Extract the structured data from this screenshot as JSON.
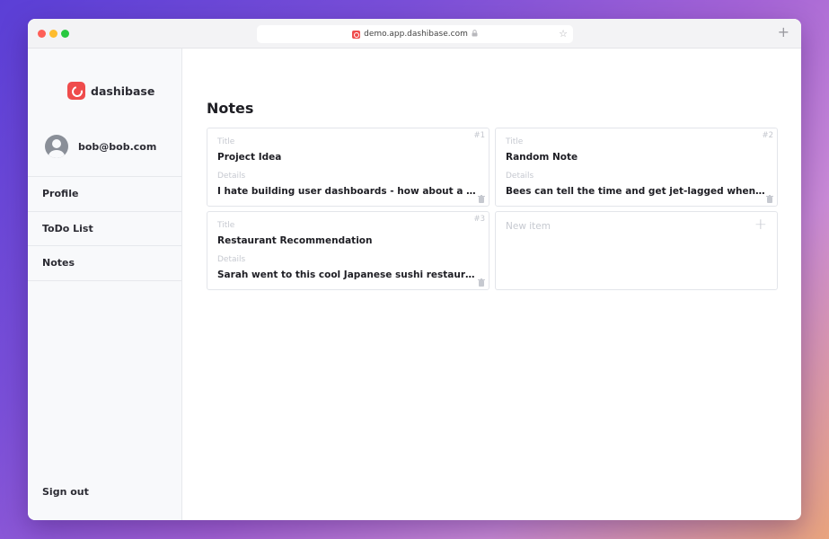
{
  "browser": {
    "url": "demo.app.dashibase.com"
  },
  "sidebar": {
    "brand": "dashibase",
    "user_email": "bob@bob.com",
    "items": [
      {
        "label": "Profile"
      },
      {
        "label": "ToDo List"
      },
      {
        "label": "Notes"
      }
    ],
    "sign_out": "Sign out"
  },
  "main": {
    "title": "Notes",
    "field_labels": {
      "title": "Title",
      "details": "Details"
    },
    "notes": [
      {
        "number": "#1",
        "title": "Project Idea",
        "details": "I hate building user dashboards - how about a no-code tool for it"
      },
      {
        "number": "#2",
        "title": "Random Note",
        "details": "Bees can tell the time and get jet-lagged when they travel far"
      },
      {
        "number": "#3",
        "title": "Restaurant Recommendation",
        "details": "Sarah went to this cool Japanese sushi restaurant downtown last week"
      }
    ],
    "new_item_label": "New item"
  },
  "colors": {
    "brand": "#ef4c4c",
    "sidebar_bg": "#f8f9fb"
  },
  "icons": {
    "url_bar": [
      "dashibase-favicon-icon",
      "lock-icon",
      "star-icon"
    ],
    "tab_bar": [
      "plus-icon"
    ],
    "notes": [
      "trash-icon",
      "plus-icon"
    ]
  }
}
